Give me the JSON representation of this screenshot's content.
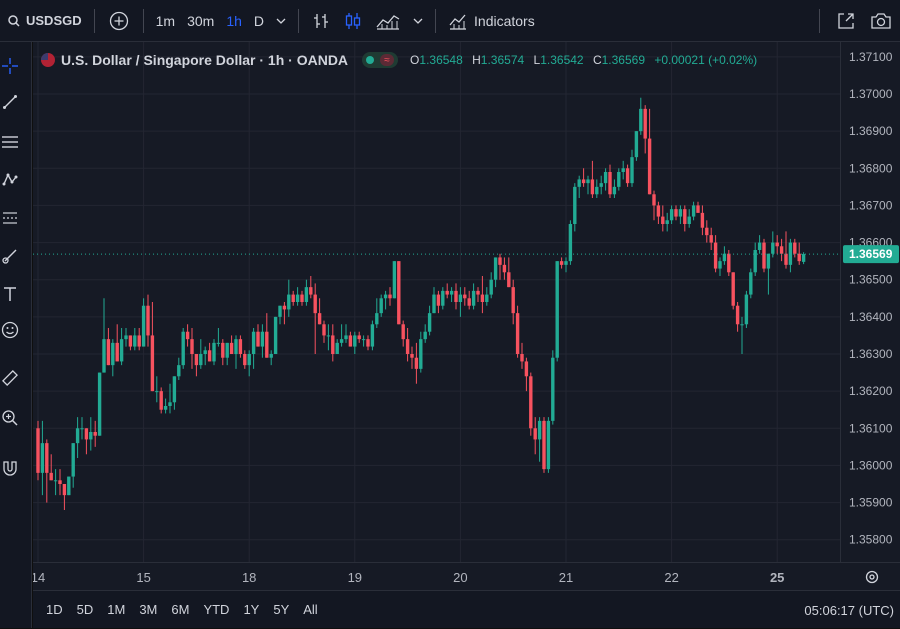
{
  "toolbar": {
    "symbol": "USDSGD",
    "intervals": [
      "1m",
      "30m",
      "1h",
      "D"
    ],
    "active_interval": "1h",
    "indicators_label": "Indicators"
  },
  "legend": {
    "title": "U.S. Dollar / Singapore Dollar · 1h · OANDA",
    "o_label": "O",
    "o": "1.36548",
    "h_label": "H",
    "h": "1.36574",
    "l_label": "L",
    "l": "1.36542",
    "c_label": "C",
    "c": "1.36569",
    "change": "+0.00021 (+0.02%)"
  },
  "bottom": {
    "ranges": [
      "1D",
      "5D",
      "1M",
      "3M",
      "6M",
      "YTD",
      "1Y",
      "5Y",
      "All"
    ],
    "clock": "05:06:17 (UTC)"
  },
  "colors": {
    "up": "#22ab94",
    "down": "#f7525f",
    "background": "#161a25",
    "grid": "#232632"
  },
  "chart_data": {
    "type": "candlestick",
    "yticks": [
      "1.37100",
      "1.37000",
      "1.36900",
      "1.36800",
      "1.36700",
      "1.36600",
      "1.36500",
      "1.36400",
      "1.36300",
      "1.36200",
      "1.36100",
      "1.36000",
      "1.35900",
      "1.35800"
    ],
    "ylim": [
      1.3574,
      1.3714
    ],
    "xticks": [
      "14",
      "15",
      "18",
      "19",
      "20",
      "21",
      "22",
      "25"
    ],
    "xtick_pos": [
      0,
      24,
      48,
      72,
      96,
      120,
      144,
      168
    ],
    "x_count": 178,
    "last_price": "1.36569",
    "ohlc": [
      [
        1.361,
        1.3612,
        1.3596,
        1.3598
      ],
      [
        1.3598,
        1.3612,
        1.3592,
        1.3606
      ],
      [
        1.3606,
        1.3607,
        1.359,
        1.3598
      ],
      [
        1.3598,
        1.3603,
        1.3596,
        1.3596
      ],
      [
        1.3596,
        1.3599,
        1.3592,
        1.3596
      ],
      [
        1.3596,
        1.3599,
        1.3592,
        1.3595
      ],
      [
        1.3595,
        1.3595,
        1.3588,
        1.3592
      ],
      [
        1.3592,
        1.3597,
        1.3592,
        1.3597
      ],
      [
        1.3597,
        1.3606,
        1.3594,
        1.3606
      ],
      [
        1.3606,
        1.3613,
        1.3602,
        1.361
      ],
      [
        1.361,
        1.3613,
        1.3607,
        1.361
      ],
      [
        1.361,
        1.361,
        1.3603,
        1.3607
      ],
      [
        1.3607,
        1.3613,
        1.3604,
        1.3609
      ],
      [
        1.3609,
        1.3612,
        1.3605,
        1.3608
      ],
      [
        1.3608,
        1.3625,
        1.3608,
        1.3625
      ],
      [
        1.3625,
        1.3645,
        1.3625,
        1.3634
      ],
      [
        1.3634,
        1.3637,
        1.3627,
        1.3627
      ],
      [
        1.3627,
        1.3634,
        1.3624,
        1.3633
      ],
      [
        1.3633,
        1.3638,
        1.3628,
        1.3628
      ],
      [
        1.3628,
        1.3637,
        1.3627,
        1.3634
      ],
      [
        1.3634,
        1.3637,
        1.3632,
        1.3635
      ],
      [
        1.3635,
        1.3635,
        1.3631,
        1.3632
      ],
      [
        1.3632,
        1.3637,
        1.3631,
        1.3635
      ],
      [
        1.3635,
        1.3637,
        1.3631,
        1.3632
      ],
      [
        1.3632,
        1.3645,
        1.3632,
        1.3643
      ],
      [
        1.3643,
        1.3646,
        1.3632,
        1.3635
      ],
      [
        1.3635,
        1.3644,
        1.362,
        1.362
      ],
      [
        1.362,
        1.3624,
        1.3617,
        1.362
      ],
      [
        1.362,
        1.3621,
        1.3614,
        1.3615
      ],
      [
        1.3615,
        1.3618,
        1.3614,
        1.3616
      ],
      [
        1.3616,
        1.3622,
        1.3614,
        1.3617
      ],
      [
        1.3617,
        1.3624,
        1.3615,
        1.3624
      ],
      [
        1.3624,
        1.3629,
        1.3623,
        1.3627
      ],
      [
        1.3627,
        1.3637,
        1.3626,
        1.3636
      ],
      [
        1.3636,
        1.3638,
        1.3632,
        1.3634
      ],
      [
        1.3634,
        1.3637,
        1.3626,
        1.363
      ],
      [
        1.363,
        1.363,
        1.3624,
        1.3627
      ],
      [
        1.3627,
        1.3634,
        1.3626,
        1.363
      ],
      [
        1.363,
        1.3632,
        1.3627,
        1.3631
      ],
      [
        1.3631,
        1.3633,
        1.3628,
        1.3628
      ],
      [
        1.3628,
        1.3634,
        1.3627,
        1.3633
      ],
      [
        1.3633,
        1.3637,
        1.3632,
        1.3633
      ],
      [
        1.3633,
        1.3634,
        1.3627,
        1.3629
      ],
      [
        1.3629,
        1.3633,
        1.3627,
        1.3633
      ],
      [
        1.3633,
        1.3635,
        1.363,
        1.363
      ],
      [
        1.363,
        1.3635,
        1.3626,
        1.3634
      ],
      [
        1.3634,
        1.3635,
        1.3629,
        1.363
      ],
      [
        1.363,
        1.3631,
        1.3626,
        1.3627
      ],
      [
        1.3627,
        1.3631,
        1.3624,
        1.363
      ],
      [
        1.363,
        1.3637,
        1.3626,
        1.3636
      ],
      [
        1.3636,
        1.3638,
        1.3632,
        1.3632
      ],
      [
        1.3632,
        1.3638,
        1.3629,
        1.3636
      ],
      [
        1.3636,
        1.3641,
        1.3629,
        1.3629
      ],
      [
        1.3629,
        1.3631,
        1.3627,
        1.363
      ],
      [
        1.363,
        1.364,
        1.363,
        1.364
      ],
      [
        1.364,
        1.3643,
        1.3638,
        1.3643
      ],
      [
        1.3643,
        1.3644,
        1.3638,
        1.3642
      ],
      [
        1.3642,
        1.365,
        1.364,
        1.3646
      ],
      [
        1.3646,
        1.3647,
        1.3643,
        1.3644
      ],
      [
        1.3644,
        1.3648,
        1.3643,
        1.3646
      ],
      [
        1.3646,
        1.3647,
        1.3643,
        1.3644
      ],
      [
        1.3644,
        1.365,
        1.3643,
        1.3648
      ],
      [
        1.3648,
        1.3651,
        1.3645,
        1.3646
      ],
      [
        1.3646,
        1.3649,
        1.363,
        1.3641
      ],
      [
        1.3641,
        1.3645,
        1.3638,
        1.3638
      ],
      [
        1.3638,
        1.3639,
        1.3633,
        1.3635
      ],
      [
        1.3635,
        1.3638,
        1.3631,
        1.3635
      ],
      [
        1.3635,
        1.3638,
        1.3628,
        1.363
      ],
      [
        1.363,
        1.3634,
        1.363,
        1.3633
      ],
      [
        1.3633,
        1.3638,
        1.3632,
        1.3634
      ],
      [
        1.3634,
        1.3638,
        1.3633,
        1.3635
      ],
      [
        1.3635,
        1.3636,
        1.3632,
        1.3632
      ],
      [
        1.3632,
        1.3636,
        1.363,
        1.3635
      ],
      [
        1.3635,
        1.3636,
        1.3633,
        1.3634
      ],
      [
        1.3634,
        1.3635,
        1.3632,
        1.3634
      ],
      [
        1.3634,
        1.3635,
        1.3631,
        1.3632
      ],
      [
        1.3632,
        1.3639,
        1.3631,
        1.3638
      ],
      [
        1.3638,
        1.3645,
        1.3637,
        1.3641
      ],
      [
        1.3641,
        1.3646,
        1.364,
        1.3645
      ],
      [
        1.3645,
        1.3647,
        1.3642,
        1.3646
      ],
      [
        1.3646,
        1.3648,
        1.3643,
        1.3645
      ],
      [
        1.3645,
        1.3655,
        1.3645,
        1.3655
      ],
      [
        1.3655,
        1.3655,
        1.3638,
        1.3638
      ],
      [
        1.3638,
        1.3639,
        1.3632,
        1.3634
      ],
      [
        1.3634,
        1.3637,
        1.3628,
        1.363
      ],
      [
        1.363,
        1.3632,
        1.3626,
        1.3629
      ],
      [
        1.3629,
        1.3633,
        1.3622,
        1.3626
      ],
      [
        1.3626,
        1.3636,
        1.3625,
        1.3634
      ],
      [
        1.3634,
        1.3638,
        1.3633,
        1.3636
      ],
      [
        1.3636,
        1.3643,
        1.3635,
        1.3641
      ],
      [
        1.3641,
        1.3648,
        1.3641,
        1.3646
      ],
      [
        1.3646,
        1.3647,
        1.3641,
        1.3643
      ],
      [
        1.3643,
        1.3648,
        1.3642,
        1.3647
      ],
      [
        1.3647,
        1.3649,
        1.3645,
        1.3646
      ],
      [
        1.3646,
        1.3648,
        1.3644,
        1.3647
      ],
      [
        1.3647,
        1.3649,
        1.3642,
        1.3644
      ],
      [
        1.3644,
        1.3648,
        1.364,
        1.3646
      ],
      [
        1.3646,
        1.3648,
        1.3643,
        1.3645
      ],
      [
        1.3645,
        1.3647,
        1.3642,
        1.3643
      ],
      [
        1.3643,
        1.3649,
        1.3642,
        1.3647
      ],
      [
        1.3647,
        1.3648,
        1.3644,
        1.3646
      ],
      [
        1.3646,
        1.3651,
        1.3641,
        1.3644
      ],
      [
        1.3644,
        1.3648,
        1.3643,
        1.3646
      ],
      [
        1.3646,
        1.3652,
        1.3645,
        1.365
      ],
      [
        1.365,
        1.3656,
        1.3648,
        1.3656
      ],
      [
        1.3656,
        1.3657,
        1.365,
        1.3654
      ],
      [
        1.3654,
        1.3656,
        1.365,
        1.3652
      ],
      [
        1.3652,
        1.3656,
        1.3648,
        1.3648
      ],
      [
        1.3648,
        1.365,
        1.3638,
        1.3641
      ],
      [
        1.3641,
        1.3643,
        1.3629,
        1.363
      ],
      [
        1.363,
        1.3633,
        1.3626,
        1.3628
      ],
      [
        1.3628,
        1.3629,
        1.362,
        1.3624
      ],
      [
        1.3624,
        1.3625,
        1.3608,
        1.361
      ],
      [
        1.361,
        1.3613,
        1.3603,
        1.3607
      ],
      [
        1.3607,
        1.3613,
        1.3601,
        1.3612
      ],
      [
        1.3612,
        1.3613,
        1.3598,
        1.3599
      ],
      [
        1.3599,
        1.3613,
        1.3598,
        1.3612
      ],
      [
        1.3612,
        1.3631,
        1.3611,
        1.3629
      ],
      [
        1.3629,
        1.3655,
        1.3628,
        1.3655
      ],
      [
        1.3655,
        1.3656,
        1.3653,
        1.3654
      ],
      [
        1.3654,
        1.3656,
        1.3652,
        1.3655
      ],
      [
        1.3655,
        1.3666,
        1.3654,
        1.3665
      ],
      [
        1.3665,
        1.3676,
        1.3663,
        1.3675
      ],
      [
        1.3675,
        1.3678,
        1.3672,
        1.3677
      ],
      [
        1.3677,
        1.368,
        1.3675,
        1.3676
      ],
      [
        1.3676,
        1.3678,
        1.3673,
        1.3677
      ],
      [
        1.3677,
        1.3682,
        1.3672,
        1.3673
      ],
      [
        1.3673,
        1.3677,
        1.3672,
        1.3675
      ],
      [
        1.3675,
        1.3678,
        1.3673,
        1.3676
      ],
      [
        1.3676,
        1.368,
        1.3674,
        1.3679
      ],
      [
        1.3679,
        1.3681,
        1.3672,
        1.3673
      ],
      [
        1.3673,
        1.3677,
        1.3672,
        1.3675
      ],
      [
        1.3675,
        1.368,
        1.3674,
        1.3679
      ],
      [
        1.3679,
        1.3682,
        1.3677,
        1.368
      ],
      [
        1.368,
        1.3681,
        1.3675,
        1.3676
      ],
      [
        1.3676,
        1.3685,
        1.3675,
        1.3683
      ],
      [
        1.3683,
        1.369,
        1.3682,
        1.369
      ],
      [
        1.369,
        1.3699,
        1.3689,
        1.3696
      ],
      [
        1.3696,
        1.3697,
        1.3684,
        1.3688
      ],
      [
        1.3688,
        1.3696,
        1.3673,
        1.3673
      ],
      [
        1.3673,
        1.3674,
        1.3666,
        1.367
      ],
      [
        1.367,
        1.3671,
        1.3665,
        1.3667
      ],
      [
        1.3667,
        1.367,
        1.3663,
        1.3665
      ],
      [
        1.3665,
        1.3668,
        1.3663,
        1.3666
      ],
      [
        1.3666,
        1.367,
        1.3665,
        1.3669
      ],
      [
        1.3669,
        1.367,
        1.3666,
        1.3667
      ],
      [
        1.3667,
        1.367,
        1.3665,
        1.3669
      ],
      [
        1.3669,
        1.367,
        1.3663,
        1.3665
      ],
      [
        1.3665,
        1.3669,
        1.3664,
        1.3667
      ],
      [
        1.3667,
        1.3671,
        1.3666,
        1.367
      ],
      [
        1.367,
        1.3671,
        1.3668,
        1.3668
      ],
      [
        1.3668,
        1.367,
        1.3662,
        1.3664
      ],
      [
        1.3664,
        1.3666,
        1.366,
        1.3662
      ],
      [
        1.3662,
        1.3664,
        1.3658,
        1.366
      ],
      [
        1.366,
        1.3662,
        1.3652,
        1.3653
      ],
      [
        1.3653,
        1.3656,
        1.3651,
        1.3655
      ],
      [
        1.3655,
        1.3659,
        1.3654,
        1.3657
      ],
      [
        1.3657,
        1.3658,
        1.3651,
        1.3652
      ],
      [
        1.3652,
        1.3652,
        1.3642,
        1.3643
      ],
      [
        1.3643,
        1.3644,
        1.3636,
        1.3638
      ],
      [
        1.3638,
        1.364,
        1.363,
        1.3638
      ],
      [
        1.3638,
        1.3647,
        1.3637,
        1.3646
      ],
      [
        1.3646,
        1.3653,
        1.3645,
        1.3652
      ],
      [
        1.3652,
        1.366,
        1.3651,
        1.3658
      ],
      [
        1.3658,
        1.3662,
        1.3657,
        1.366
      ],
      [
        1.366,
        1.3661,
        1.3652,
        1.3653
      ],
      [
        1.3653,
        1.3657,
        1.3646,
        1.3657
      ],
      [
        1.3657,
        1.3663,
        1.3656,
        1.366
      ],
      [
        1.366,
        1.3662,
        1.3657,
        1.3659
      ],
      [
        1.3659,
        1.3661,
        1.3655,
        1.3657
      ],
      [
        1.3657,
        1.3663,
        1.3653,
        1.3654
      ],
      [
        1.3654,
        1.3661,
        1.3652,
        1.366
      ],
      [
        1.366,
        1.3661,
        1.3656,
        1.3657
      ],
      [
        1.3657,
        1.366,
        1.3654,
        1.3655
      ],
      [
        1.36548,
        1.36574,
        1.36542,
        1.36569
      ]
    ]
  }
}
